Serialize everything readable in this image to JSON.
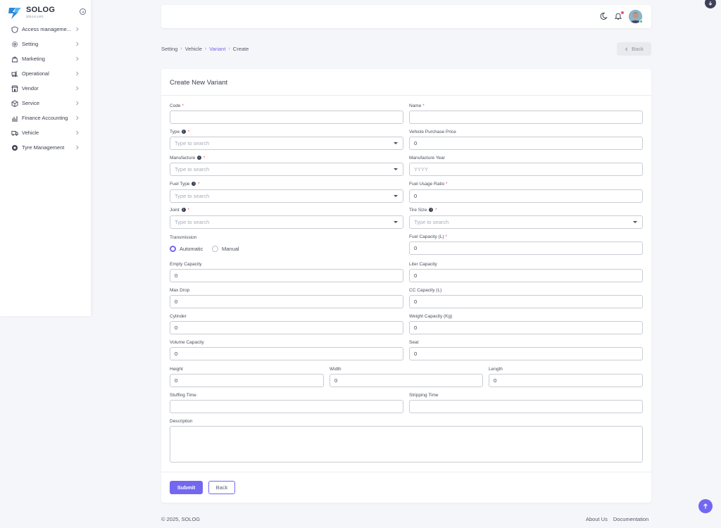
{
  "brand": {
    "name": "SOLOG",
    "version": "2024.8.14#1"
  },
  "sidebar": {
    "items": [
      {
        "label": "Access manageme...",
        "icon": "shield-icon"
      },
      {
        "label": "Setting",
        "icon": "gear-icon"
      },
      {
        "label": "Marketing",
        "icon": "bag-icon"
      },
      {
        "label": "Operational",
        "icon": "forklift-icon"
      },
      {
        "label": "Vendor",
        "icon": "store-icon"
      },
      {
        "label": "Service",
        "icon": "box-icon"
      },
      {
        "label": "Finance Accounting",
        "icon": "chart-icon"
      },
      {
        "label": "Vehicle",
        "icon": "truck-icon"
      },
      {
        "label": "Tyre Management",
        "icon": "tyre-icon"
      }
    ]
  },
  "breadcrumb": {
    "items": [
      "Setting",
      "Vehicle",
      "Variant",
      "Create"
    ],
    "separator": "›"
  },
  "top_back_label": "Back",
  "card": {
    "title": "Create New Variant",
    "fields": {
      "code": {
        "label": "Code",
        "value": ""
      },
      "name": {
        "label": "Name",
        "value": ""
      },
      "type": {
        "label": "Type",
        "placeholder": "Type to search"
      },
      "vehicle_purchase_price": {
        "label": "Vehicle Purchase Price",
        "value": "0"
      },
      "manufacture": {
        "label": "Manufacture",
        "placeholder": "Type to search"
      },
      "manufacture_year": {
        "label": "Manufacture Year",
        "placeholder": "YYYY"
      },
      "fuel_type": {
        "label": "Fuel Type",
        "placeholder": "Type to search"
      },
      "fuel_usage_ratio": {
        "label": "Fuel Usage Ratio",
        "value": "0"
      },
      "joint": {
        "label": "Joint",
        "placeholder": "Type to search"
      },
      "tire_size": {
        "label": "Tire Size",
        "placeholder": "Type to search"
      },
      "transmission": {
        "label": "Transmission",
        "options": [
          "Automatic",
          "Manual"
        ],
        "selected": "Automatic"
      },
      "fuel_capacity": {
        "label": "Fuel Capacity (L)",
        "value": "0"
      },
      "empty_capacity": {
        "label": "Empty Capacity",
        "value": "0"
      },
      "liter_capacity": {
        "label": "Liter Capacity",
        "value": "0"
      },
      "max_drop": {
        "label": "Max Drop",
        "value": "0"
      },
      "cc_capacity": {
        "label": "CC Capacity (L)",
        "value": "0"
      },
      "cylinder": {
        "label": "Cylinder",
        "value": "0"
      },
      "weight_capacity": {
        "label": "Weight Capacity (Kg)",
        "value": "0"
      },
      "volume_capacity": {
        "label": "Volume Capacity",
        "value": "0"
      },
      "seat": {
        "label": "Seat",
        "value": "0"
      },
      "height": {
        "label": "Height",
        "value": "0"
      },
      "width": {
        "label": "Width",
        "value": "0"
      },
      "length": {
        "label": "Length",
        "value": "0"
      },
      "stuffing_time": {
        "label": "Stuffing Time",
        "value": ""
      },
      "stripping_time": {
        "label": "Stripping Time",
        "value": ""
      },
      "description": {
        "label": "Description",
        "value": ""
      }
    },
    "required_mark": "*",
    "info_mark": "i",
    "submit_label": "Submit",
    "back_label": "Back"
  },
  "footer": {
    "copyright": "© 2025, SOLOG",
    "links": [
      "About Us",
      "Documentation"
    ]
  },
  "colors": {
    "primary": "#7367f0",
    "required": "#ea5455",
    "notification": "#f0506e",
    "online": "#32c787"
  }
}
